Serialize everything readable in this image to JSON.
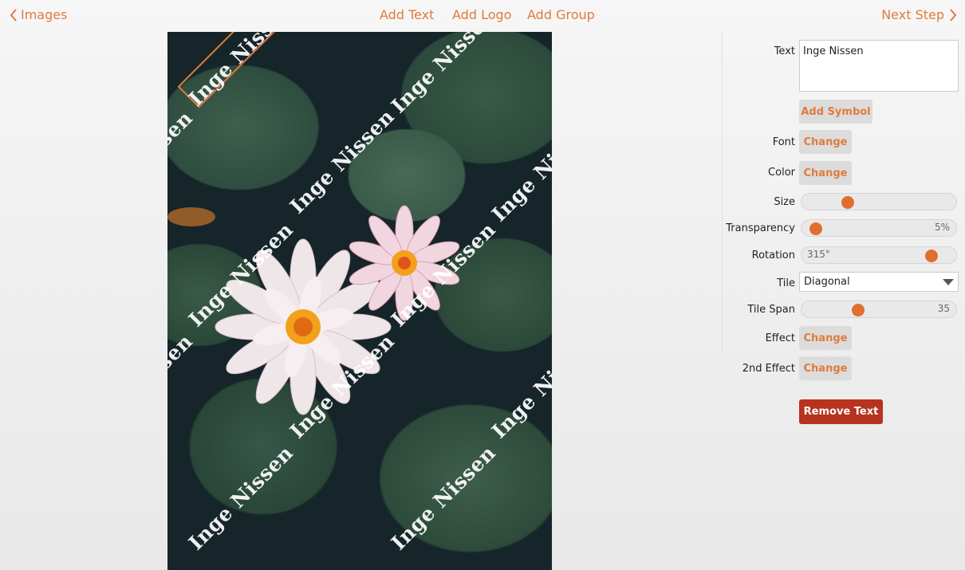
{
  "nav": {
    "back_label": "Images",
    "add_text_label": "Add Text",
    "add_logo_label": "Add Logo",
    "add_group_label": "Add Group",
    "next_label": "Next Step"
  },
  "canvas": {
    "watermark_text": "Inge Nissen"
  },
  "panel": {
    "text": {
      "label": "Text",
      "value": "Inge Nissen"
    },
    "add_symbol_label": "Add Symbol",
    "font": {
      "label": "Font",
      "button": "Change"
    },
    "color": {
      "label": "Color",
      "button": "Change"
    },
    "size": {
      "label": "Size",
      "value_fraction": 0.28
    },
    "transparency": {
      "label": "Transparency",
      "value": "5%"
    },
    "rotation": {
      "label": "Rotation",
      "value": "315°"
    },
    "tile": {
      "label": "Tile",
      "selected": "Diagonal"
    },
    "tile_span": {
      "label": "Tile Span",
      "value": "35"
    },
    "effect": {
      "label": "Effect",
      "button": "Change"
    },
    "second_effect": {
      "label": "2nd Effect",
      "button": "Change"
    },
    "remove_label": "Remove Text"
  },
  "colors": {
    "accent": "#e07b3c",
    "remove": "#b7331f"
  },
  "icons": {
    "back": "chevron-left-icon",
    "next": "chevron-right-icon",
    "dropdown": "triangle-down-icon"
  }
}
